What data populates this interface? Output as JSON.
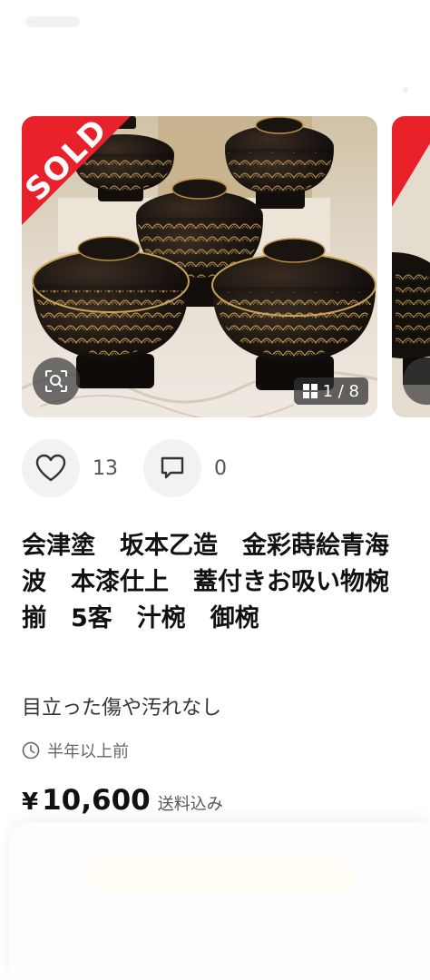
{
  "gallery": {
    "sold_label": "SOLD",
    "counter": "1 / 8",
    "icons": {
      "zoom": "image-search-icon",
      "grid": "grid-icon"
    }
  },
  "actions": {
    "likes": {
      "icon": "heart-icon",
      "count": "13"
    },
    "comments": {
      "icon": "comment-icon",
      "count": "0"
    }
  },
  "item": {
    "title": "会津塗　坂本乙造　金彩蒔絵青海波　本漆仕上　蓋付きお吸い物椀揃　5客　汁椀　御椀",
    "condition": "目立った傷や汚れなし",
    "posted": "半年以上前",
    "posted_icon": "clock-icon",
    "currency": "¥",
    "price": "10,600",
    "shipping_note": "送料込み"
  },
  "colors": {
    "sold_ribbon": "#e8212b",
    "text": "#222222",
    "muted": "#666666"
  }
}
